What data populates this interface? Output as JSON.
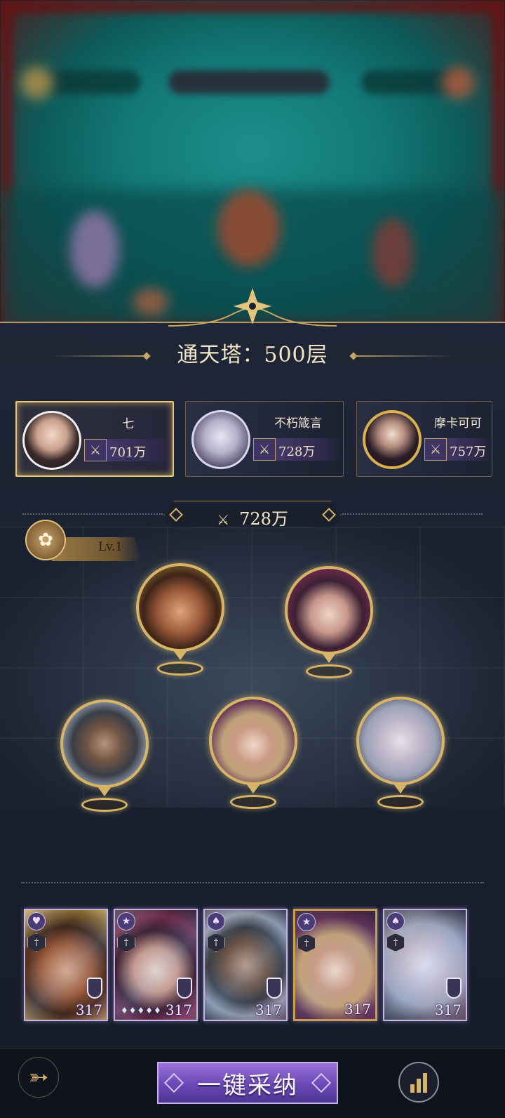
{
  "title": "通天塔：500层",
  "players": [
    {
      "name": "七",
      "power": "701万",
      "active": true
    },
    {
      "name": "不朽箴言",
      "power": "728万",
      "active": false
    },
    {
      "name": "摩卡可可",
      "power": "757万",
      "active": false
    }
  ],
  "team_power": "728万",
  "level_tag": "Lv.1",
  "hero_cards": [
    {
      "level": "317",
      "type_icon": "heart-icon",
      "gold": false
    },
    {
      "level": "317",
      "type_icon": "star-icon",
      "gold": false,
      "stars": "♦♦♦♦♦"
    },
    {
      "level": "317",
      "type_icon": "spade-icon",
      "gold": false
    },
    {
      "level": "317",
      "type_icon": "star-icon",
      "gold": true
    },
    {
      "level": "317",
      "type_icon": "spade-icon",
      "gold": false
    }
  ],
  "footer": {
    "collect_label": "一键采纳"
  },
  "colors": {
    "gold_accent": "#d8b467",
    "purple_button": "#6a48b6",
    "panel_bg": "#1a2131"
  }
}
